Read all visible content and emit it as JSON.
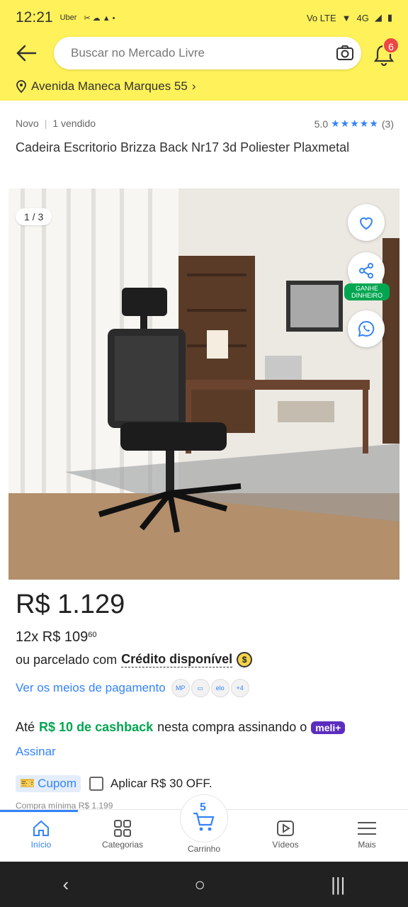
{
  "status_bar": {
    "time": "12:21",
    "apps": "Uber",
    "network": "Vo LTE",
    "signal": "4G"
  },
  "header": {
    "search_placeholder": "Buscar no Mercado Livre",
    "notifications_count": "6",
    "address": "Avenida Maneca Marques 55"
  },
  "product": {
    "condition": "Novo",
    "sold": "1 vendido",
    "rating": "5.0",
    "reviews": "(3)",
    "title": "Cadeira Escritorio Brizza Back Nr17 3d Poliester Plaxmetal",
    "image_counter": "1 / 3",
    "share_label": "GANHE DINHEIRO"
  },
  "price": {
    "main": "R$ 1.129",
    "installments_prefix": "12x R$ 109",
    "installments_cents": "60",
    "credit_prefix": "ou parcelado com",
    "credit_bold": "Crédito disponível",
    "payment_link": "Ver os meios de pagamento",
    "payment_more": "+4"
  },
  "cashback": {
    "prefix": "Até",
    "amount": "R$ 10 de cashback",
    "suffix": "nesta compra assinando o",
    "brand": "meli+",
    "action": "Assinar"
  },
  "coupon": {
    "label": "Cupom",
    "apply_text": "Aplicar R$ 30 OFF.",
    "minimum": "Compra mínima R$ 1.199"
  },
  "bottom_nav": {
    "home": "Início",
    "categories": "Categorias",
    "cart": "Carrinho",
    "cart_count": "5",
    "videos": "Vídeos",
    "more": "Mais"
  },
  "colors": {
    "brand_yellow": "#fff159",
    "accent_blue": "#3483fa",
    "cashback_green": "#00a650",
    "meli_purple": "#5c2dbf"
  }
}
